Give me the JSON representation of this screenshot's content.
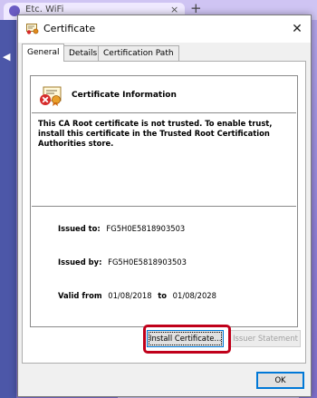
{
  "browser": {
    "tab_title": "Etc. WiFi",
    "tab_close": "×",
    "new_tab": "+"
  },
  "dialog": {
    "title": "Certificate",
    "close_glyph": "✕",
    "tabs": [
      {
        "label": "General"
      },
      {
        "label": "Details"
      },
      {
        "label": "Certification Path"
      }
    ],
    "info": {
      "heading": "Certificate Information",
      "message": "This CA Root certificate is not trusted. To enable trust, install this certificate in the Trusted Root Certification Authorities store."
    },
    "fields": {
      "issued_to_label": "Issued to:",
      "issued_to_value": "FG5H0E5818903503",
      "issued_by_label": "Issued by:",
      "issued_by_value": "FG5H0E5818903503",
      "valid_from_label": "Valid from",
      "valid_from_value": "01/08/2018",
      "valid_to_label": "to",
      "valid_to_value": "01/08/2028"
    },
    "buttons": {
      "install": "Install Certificate...",
      "issuer": "Issuer Statement",
      "ok": "OK"
    }
  }
}
